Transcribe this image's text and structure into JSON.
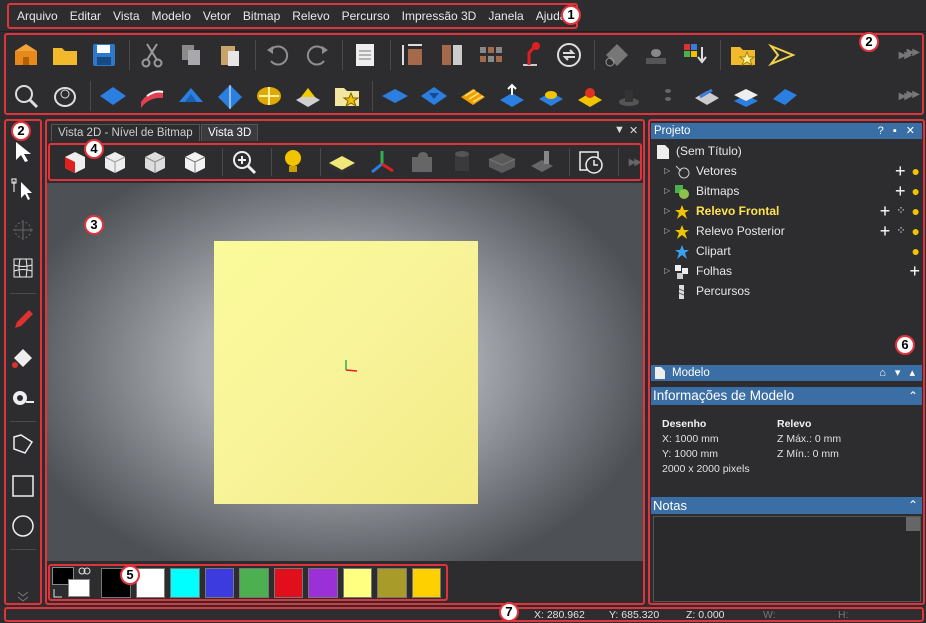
{
  "menu": [
    "Arquivo",
    "Editar",
    "Vista",
    "Modelo",
    "Vetor",
    "Bitmap",
    "Relevo",
    "Percurso",
    "Impressão 3D",
    "Janela",
    "Ajuda"
  ],
  "callouts": [
    "1",
    "2",
    "2",
    "3",
    "4",
    "5",
    "6",
    "7"
  ],
  "tabs": {
    "tab1": "Vista 2D - Nível de Bitmap",
    "tab2": "Vista 3D"
  },
  "palette": [
    "#000000",
    "#ffffff",
    "#00ffff",
    "#3b3bdf",
    "#4caf50",
    "#e00f1b",
    "#9b30d9",
    "#ffff80",
    "#a89b2a",
    "#ffd000"
  ],
  "project": {
    "title": "Projeto",
    "root": "(Sem Título)",
    "items": [
      "Vetores",
      "Bitmaps",
      "Relevo Frontal",
      "Relevo Posterior",
      "Clipart",
      "Folhas",
      "Percursos"
    ]
  },
  "model": {
    "header": "Modelo",
    "info_title": "Informações de Modelo",
    "drawing_label": "Desenho",
    "x": "X: 1000 mm",
    "y": "Y: 1000 mm",
    "pixels": "2000 x 2000 pixels",
    "relief_label": "Relevo",
    "zmax": "Z Máx.: 0 mm",
    "zmin": "Z Mín.: 0 mm"
  },
  "notes": {
    "title": "Notas"
  },
  "status": {
    "x": "X: 280.962",
    "y": "Y: 685.320",
    "z": "Z: 0.000",
    "w": "W:",
    "h": "H:"
  },
  "colors": {
    "accent": "#3a6ea5",
    "callout": "#e0333b",
    "relief": "#f8f49a"
  }
}
